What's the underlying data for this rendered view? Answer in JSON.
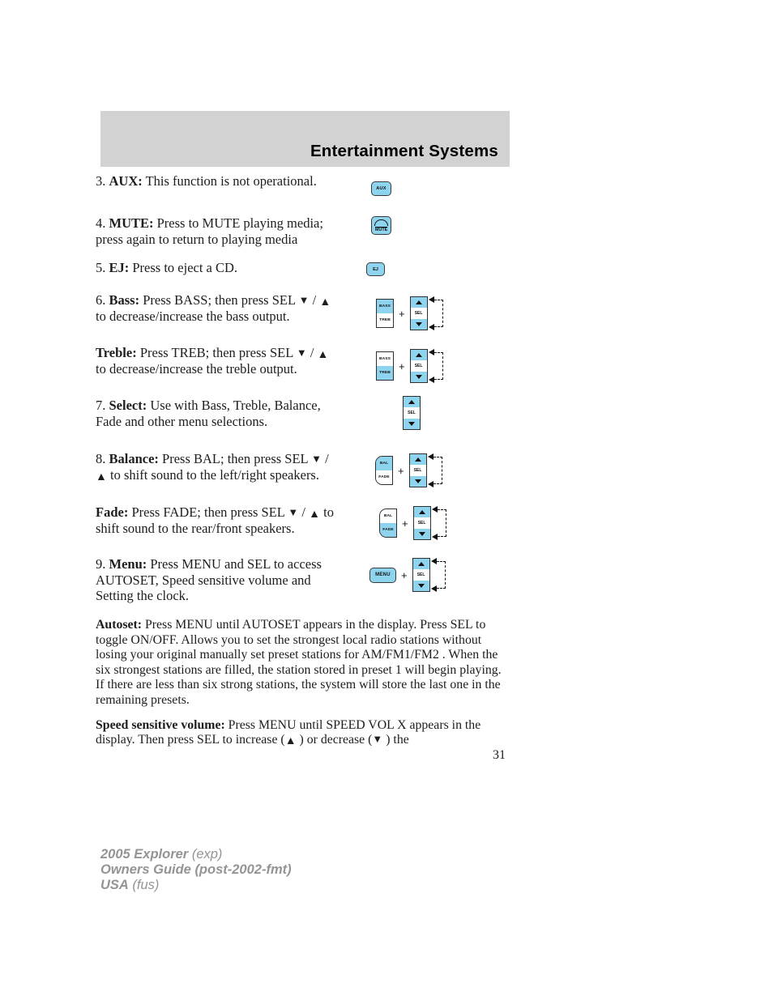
{
  "header": {
    "title": "Entertainment Systems"
  },
  "items": [
    {
      "id": "aux",
      "number": "3.",
      "term": "AUX:",
      "text": " This function is not operational.",
      "icon": "aux-button-icon",
      "icon_label": "AUX"
    },
    {
      "id": "mute",
      "number": "4.",
      "term": "MUTE:",
      "text": " Press to MUTE playing media; press again to return to playing media",
      "icon": "mute-button-icon",
      "icon_label": "MUTE"
    },
    {
      "id": "ej",
      "number": "5.",
      "term": "EJ:",
      "text": " Press to eject a CD.",
      "icon": "eject-button-icon",
      "icon_label": "EJ"
    },
    {
      "id": "bass",
      "number": "6.",
      "term": "Bass:",
      "text_a": " Press BASS; then press SEL ",
      "down": "▼",
      "sep": " / ",
      "up": "▲",
      "text_b": "  to decrease/increase the bass output.",
      "icon": "bass-select-diagram",
      "stack_top": "BASS",
      "stack_bottom": "TREB",
      "highlight": "top",
      "sel_label": "SEL",
      "plus": "+"
    },
    {
      "id": "treble",
      "number": "",
      "term": "Treble:",
      "text_a": " Press TREB; then press SEL ",
      "down": "▼",
      "sep": " / ",
      "up": "▲",
      "text_b": "  to decrease/increase the treble output.",
      "icon": "treble-select-diagram",
      "stack_top": "BASS",
      "stack_bottom": "TREB",
      "highlight": "bottom",
      "sel_label": "SEL",
      "plus": "+"
    },
    {
      "id": "select",
      "number": "7.",
      "term": "Select:",
      "text": " Use with Bass, Treble, Balance, Fade and other menu selections.",
      "icon": "select-button-icon",
      "sel_label": "SEL"
    },
    {
      "id": "balance",
      "number": "8.",
      "term": "Balance:",
      "text_a": " Press BAL; then press SEL ",
      "down": "▼",
      "sep": " / ",
      "up": "▲",
      "text_b": "  to shift sound to the left/right speakers.",
      "icon": "balance-select-diagram",
      "stack_top": "BAL",
      "stack_bottom": "FADE",
      "highlight": "top",
      "sel_label": "SEL",
      "plus": "+"
    },
    {
      "id": "fade",
      "number": "",
      "term": "Fade:",
      "text_a": " Press FADE; then press SEL ",
      "down": "▼",
      "sep": " / ",
      "up": "▲",
      "text_b": "  to shift sound to the rear/front speakers.",
      "icon": "fade-select-diagram",
      "stack_top": "BAL",
      "stack_bottom": "FADE",
      "highlight": "bottom",
      "sel_label": "SEL",
      "plus": "+"
    },
    {
      "id": "menu",
      "number": "9.",
      "term": "Menu:",
      "text": " Press MENU and SEL to access AUTOSET, Speed sensitive volume and Setting the clock.",
      "icon": "menu-select-diagram",
      "icon_label": "MENU",
      "sel_label": "SEL",
      "plus": "+"
    }
  ],
  "paragraphs": [
    {
      "id": "autoset",
      "term": "Autoset:",
      "text": " Press MENU until AUTOSET appears in the display. Press SEL to toggle ON/OFF. Allows you to set the strongest local radio stations without losing your original manually set preset stations for AM/FM1/FM2 . When the six strongest stations are filled, the station stored in preset 1 will begin playing. If there are less than six strong stations, the system will store the last one in the remaining presets."
    },
    {
      "id": "speed-sensitive-volume",
      "term": "Speed sensitive volume:",
      "text_a": " Press MENU until SPEED VOL X appears in the display. Then press SEL to increase (",
      "up": "▲",
      "text_b": " ) or decrease (",
      "down": "▼",
      "text_c": " ) the"
    }
  ],
  "page_number": "31",
  "footer": {
    "line1_bold": "2005 Explorer",
    "line1_rest": " (exp)",
    "line2_bold": "Owners Guide (post-2002-fmt)",
    "line2_rest": "",
    "line3_bold": "USA",
    "line3_rest": " (fus)"
  },
  "colors": {
    "header_band": "#d2d2d2",
    "button_blue": "#8fd4ef",
    "footer_gray": "#949494"
  }
}
